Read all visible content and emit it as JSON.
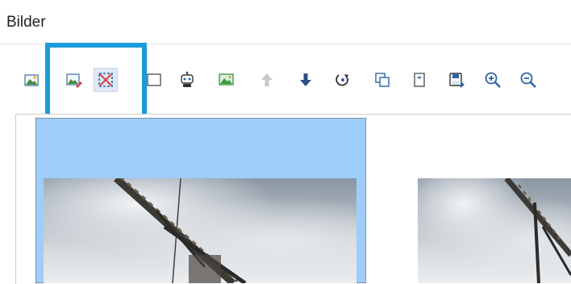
{
  "tab": {
    "label": "Bilder"
  },
  "toolbar": {
    "buttons": [
      {
        "name": "insert-image-icon"
      },
      {
        "name": "edit-image-icon"
      },
      {
        "name": "crop-image-icon",
        "active": true
      },
      {
        "name": "frame-icon"
      },
      {
        "name": "robot-icon"
      },
      {
        "name": "image-adjust-icon"
      },
      {
        "name": "arrow-up-icon",
        "disabled": true
      },
      {
        "name": "arrow-down-icon"
      },
      {
        "name": "rotate-icon"
      },
      {
        "name": "copy-icon"
      },
      {
        "name": "document-icon"
      },
      {
        "name": "save-image-icon"
      },
      {
        "name": "zoom-in-icon"
      },
      {
        "name": "zoom-out-icon"
      }
    ]
  },
  "colors": {
    "highlight": "#1a9bdc",
    "selection": "#9fcdf9",
    "icon_blue": "#2e63a8",
    "icon_red": "#d24a4a",
    "icon_green": "#3f9a48"
  }
}
